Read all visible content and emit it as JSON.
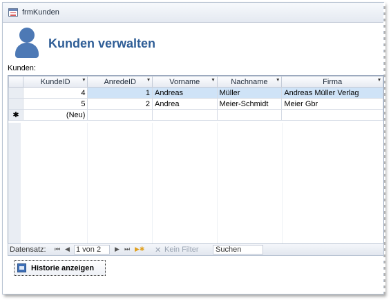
{
  "window": {
    "title": "frmKunden"
  },
  "header": {
    "title": "Kunden verwalten"
  },
  "subform": {
    "label": "Kunden:",
    "columns": [
      {
        "key": "KundeID",
        "label": "KundeID"
      },
      {
        "key": "AnredeID",
        "label": "AnredeID"
      },
      {
        "key": "Vorname",
        "label": "Vorname"
      },
      {
        "key": "Nachname",
        "label": "Nachname"
      },
      {
        "key": "Firma",
        "label": "Firma"
      }
    ],
    "rows": [
      {
        "KundeID": "4",
        "AnredeID": "1",
        "Vorname": "Andreas",
        "Nachname": "Müller",
        "Firma": "Andreas Müller Verlag"
      },
      {
        "KundeID": "5",
        "AnredeID": "2",
        "Vorname": "Andrea",
        "Nachname": "Meier-Schmidt",
        "Firma": "Meier Gbr"
      }
    ],
    "new_row": {
      "marker": "✱",
      "KundeID": "(Neu)"
    }
  },
  "navigation": {
    "record_label": "Datensatz:",
    "first_glyph": "⏮",
    "prev_glyph": "◀",
    "position": "1 von 2",
    "next_glyph": "▶",
    "last_glyph": "⏭",
    "new_glyph": "▶✱",
    "filter_label": "Kein Filter",
    "search_value": "Suchen"
  },
  "actions": {
    "history_button": "Historie anzeigen"
  }
}
